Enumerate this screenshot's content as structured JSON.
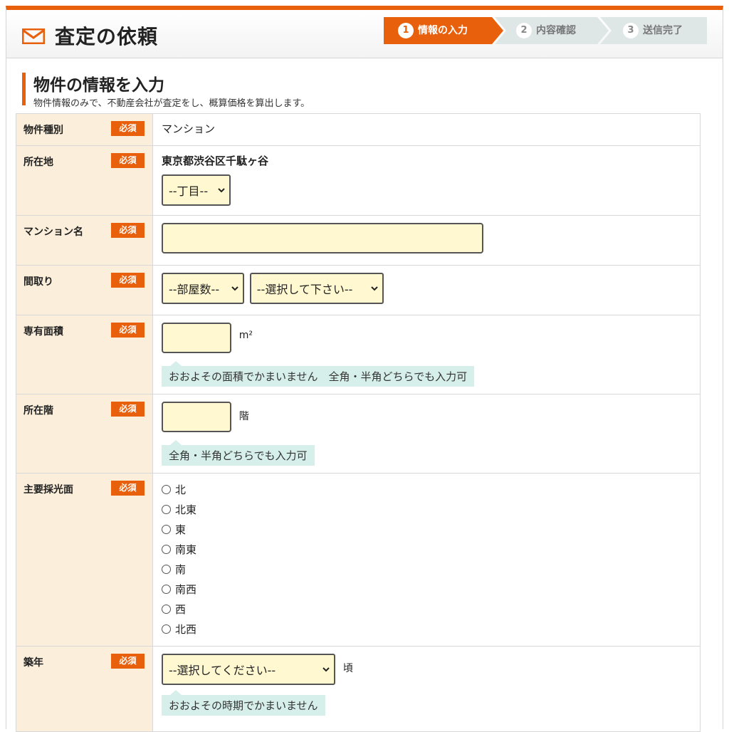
{
  "header": {
    "title": "査定の依頼",
    "steps": [
      {
        "num": "1",
        "label": "情報の入力"
      },
      {
        "num": "2",
        "label": "内容確認"
      },
      {
        "num": "3",
        "label": "送信完了"
      }
    ]
  },
  "section": {
    "title": "物件の情報を入力",
    "description": "物件情報のみで、不動産会社が査定をし、概算価格を算出します。"
  },
  "required_label": "必須",
  "colors": {
    "accent": "#e8600c",
    "label_bg": "#fbefdb",
    "input_bg": "#fff8d0",
    "hint_bg": "#d6efea"
  },
  "fields": {
    "property_type": {
      "label": "物件種別",
      "value": "マンション"
    },
    "location": {
      "label": "所在地",
      "address": "東京都渋谷区千駄ヶ谷",
      "chome_select": "--丁目--"
    },
    "mansion_name": {
      "label": "マンション名",
      "value": ""
    },
    "layout": {
      "label": "間取り",
      "rooms_select": "--部屋数--",
      "type_select": "--選択して下さい--"
    },
    "area": {
      "label": "専有面積",
      "value": "",
      "unit": "m²",
      "hint": "おおよその面積でかまいません　全角・半角どちらでも入力可"
    },
    "floor": {
      "label": "所在階",
      "value": "",
      "unit": "階",
      "hint": "全角・半角どちらでも入力可"
    },
    "orientation": {
      "label": "主要採光面",
      "options": [
        "北",
        "北東",
        "東",
        "南東",
        "南",
        "南西",
        "西",
        "北西"
      ]
    },
    "built_year": {
      "label": "築年",
      "select": "--選択してください--",
      "unit": "頃",
      "hint": "おおよその時期でかまいません"
    }
  }
}
